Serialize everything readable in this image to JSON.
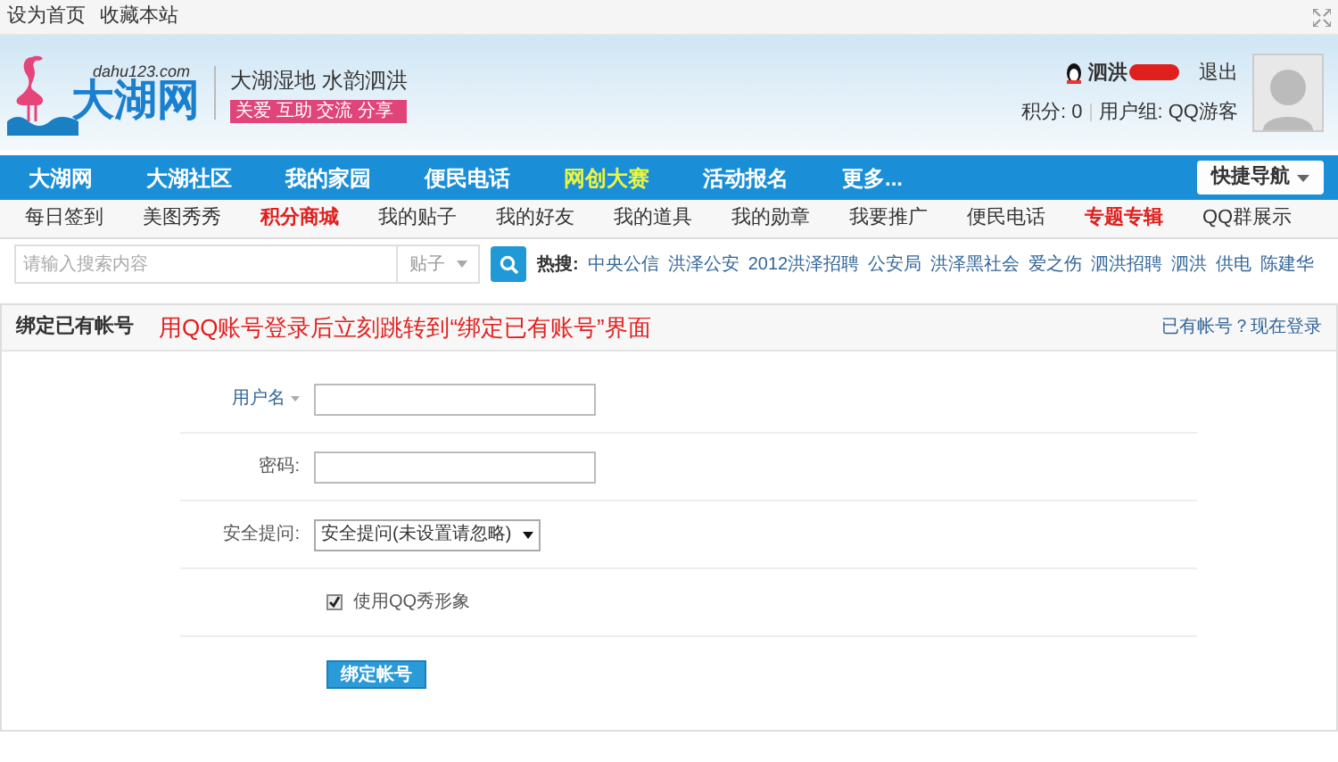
{
  "top_links": [
    "设为首页",
    "收藏本站"
  ],
  "logo": {
    "domain": "dahu123.com",
    "name": "大湖网",
    "slogan": "大湖湿地 水韵泗洪",
    "tags": "关爱 互助 交流 分享"
  },
  "user": {
    "name": "泗洪",
    "logout": "退出",
    "points": "积分: 0",
    "group": "用户组: QQ游客"
  },
  "main_nav": [
    {
      "label": "大湖网",
      "highlighted": false
    },
    {
      "label": "大湖社区",
      "highlighted": false
    },
    {
      "label": "我的家园",
      "highlighted": false
    },
    {
      "label": "便民电话",
      "highlighted": false
    },
    {
      "label": "网创大赛",
      "highlighted": true
    },
    {
      "label": "活动报名",
      "highlighted": false
    },
    {
      "label": "更多...",
      "highlighted": false
    }
  ],
  "quick_nav": "快捷导航",
  "sub_nav": [
    {
      "label": "每日签到",
      "highlighted": false
    },
    {
      "label": "美图秀秀",
      "highlighted": false
    },
    {
      "label": "积分商城",
      "highlighted": true
    },
    {
      "label": "我的贴子",
      "highlighted": false
    },
    {
      "label": "我的好友",
      "highlighted": false
    },
    {
      "label": "我的道具",
      "highlighted": false
    },
    {
      "label": "我的勋章",
      "highlighted": false
    },
    {
      "label": "我要推广",
      "highlighted": false
    },
    {
      "label": "便民电话",
      "highlighted": false
    },
    {
      "label": "专题专辑",
      "highlighted": true
    },
    {
      "label": "QQ群展示",
      "highlighted": false
    }
  ],
  "search": {
    "placeholder": "请输入搜索内容",
    "scope": "贴子",
    "hot_label": "热搜:",
    "hot": [
      "中央公信",
      "洪泽公安",
      "2012洪泽招聘",
      "公安局",
      "洪泽黑社会",
      "爱之伤",
      "泗洪招聘",
      "泗洪",
      "供电",
      "陈建华"
    ]
  },
  "panel": {
    "title": "绑定已有帐号",
    "note": "用QQ账号登录后立刻跳转到“绑定已有账号”界面",
    "login_link": "已有帐号？现在登录"
  },
  "form": {
    "fields": [
      {
        "kind": "text",
        "label": "用户名"
      },
      {
        "kind": "password",
        "label": "密码:"
      },
      {
        "kind": "select",
        "label": "安全提问:",
        "value": "安全提问(未设置请忽略)"
      }
    ],
    "checkbox": {
      "label": "使用QQ秀形象",
      "checked": true
    },
    "submit": "绑定帐号"
  }
}
